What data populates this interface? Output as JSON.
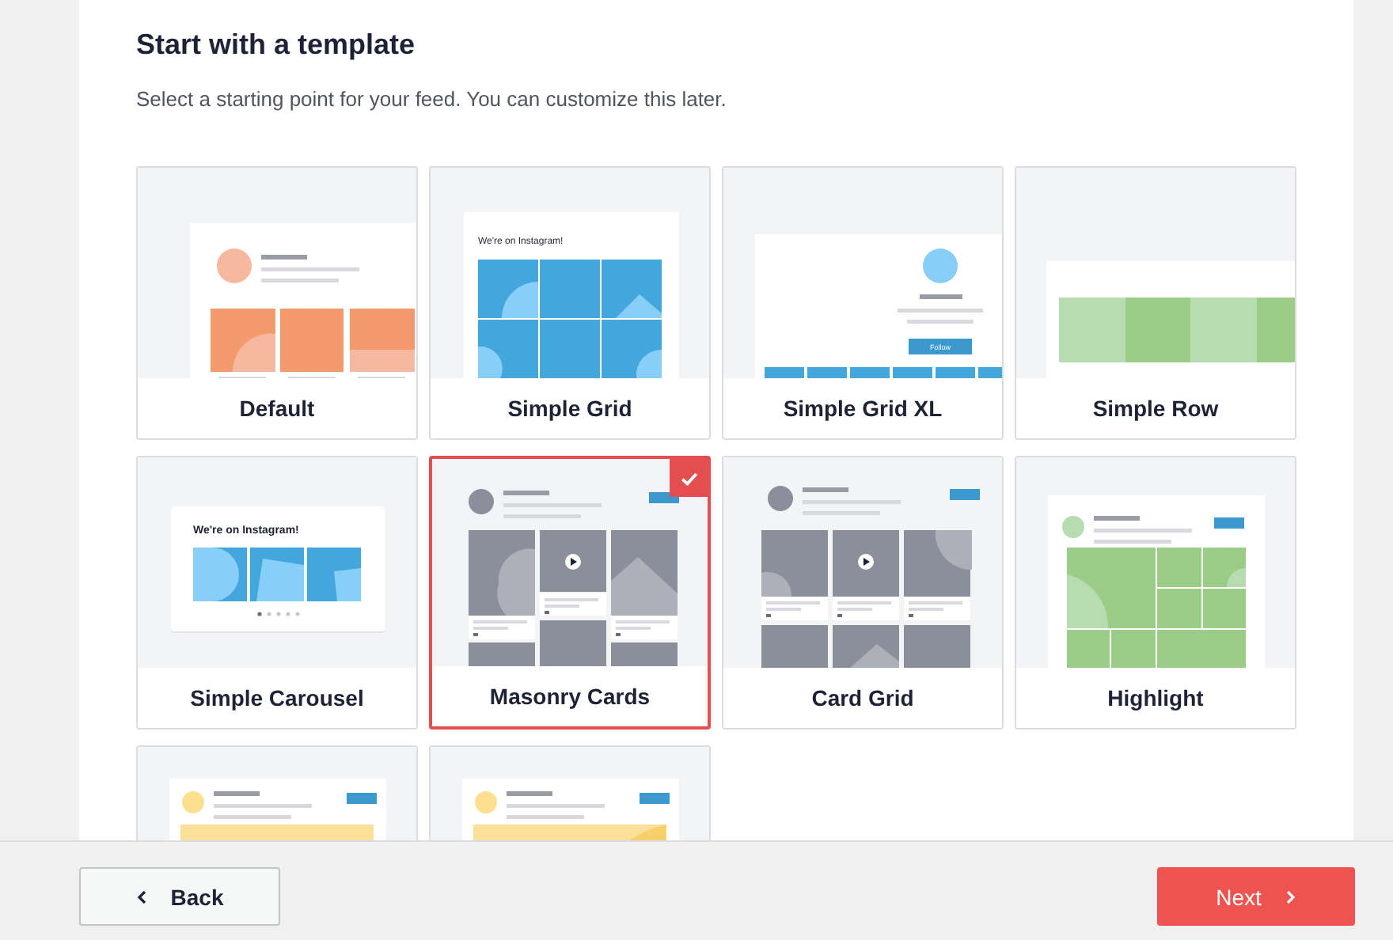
{
  "heading": "Start with a template",
  "subtitle": "Select a starting point for your feed. You can customize this later.",
  "templates": [
    {
      "label": "Default",
      "kind": "profile",
      "selected": false
    },
    {
      "label": "Simple Grid",
      "kind": "grid",
      "selected": false,
      "heading": "We're on Instagram!"
    },
    {
      "label": "Simple Grid XL",
      "kind": "gridxl",
      "selected": false,
      "button_text": "Follow"
    },
    {
      "label": "Simple Row",
      "kind": "row",
      "selected": false
    },
    {
      "label": "Simple Carousel",
      "kind": "carousel",
      "selected": false,
      "heading": "We're on Instagram!"
    },
    {
      "label": "Masonry Cards",
      "kind": "masonry",
      "selected": true
    },
    {
      "label": "Card Grid",
      "kind": "cards",
      "selected": false
    },
    {
      "label": "Highlight",
      "kind": "highlight",
      "selected": false
    },
    {
      "kind": "banner",
      "selected": false
    },
    {
      "kind": "bannershape",
      "selected": false
    }
  ],
  "footer": {
    "back": "Back",
    "next": "Next"
  }
}
